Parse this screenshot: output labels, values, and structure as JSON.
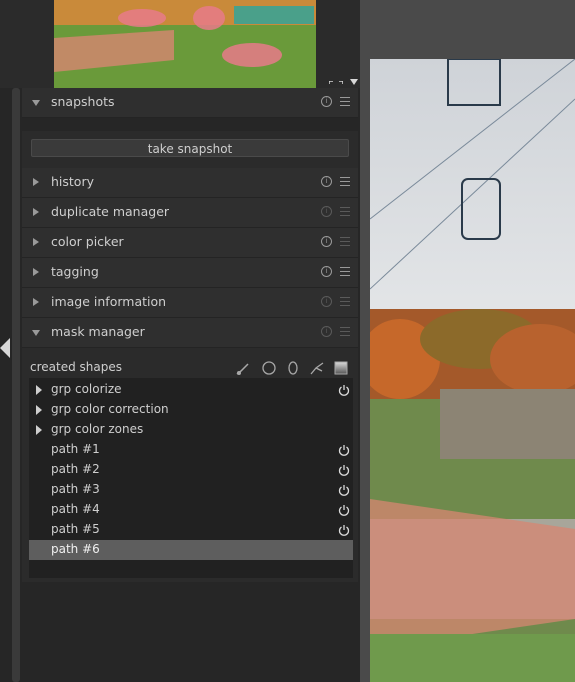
{
  "modules": [
    {
      "label": "snapshots",
      "expanded": true,
      "info_active": true
    },
    {
      "label": "history",
      "expanded": false,
      "info_active": true
    },
    {
      "label": "duplicate manager",
      "expanded": false,
      "info_active": false
    },
    {
      "label": "color picker",
      "expanded": false,
      "info_active": true
    },
    {
      "label": "tagging",
      "expanded": false,
      "info_active": true
    },
    {
      "label": "image information",
      "expanded": false,
      "info_active": false
    },
    {
      "label": "mask manager",
      "expanded": true,
      "info_active": false
    }
  ],
  "snapshots": {
    "take_snapshot_label": "take snapshot"
  },
  "mask_manager": {
    "created_shapes_label": "created shapes",
    "tools": [
      "brush-icon",
      "circle-icon",
      "ellipse-icon",
      "path-icon",
      "gradient-icon"
    ],
    "shapes": [
      {
        "label": "grp colorize",
        "group": true,
        "power": true,
        "selected": false
      },
      {
        "label": "grp color correction",
        "group": true,
        "power": false,
        "selected": false
      },
      {
        "label": "grp color zones",
        "group": true,
        "power": false,
        "selected": false
      },
      {
        "label": "path #1",
        "group": false,
        "power": true,
        "selected": false
      },
      {
        "label": "path #2",
        "group": false,
        "power": true,
        "selected": false
      },
      {
        "label": "path #3",
        "group": false,
        "power": true,
        "selected": false
      },
      {
        "label": "path #4",
        "group": false,
        "power": true,
        "selected": false
      },
      {
        "label": "path #5",
        "group": false,
        "power": true,
        "selected": false
      },
      {
        "label": "path #6",
        "group": false,
        "power": false,
        "selected": true
      }
    ]
  },
  "colors": {
    "panel_bg": "#262626",
    "module_header": "#2f2f2f",
    "selected_row": "#5e5e5e",
    "mask_overlay": "#ff6a6a"
  }
}
